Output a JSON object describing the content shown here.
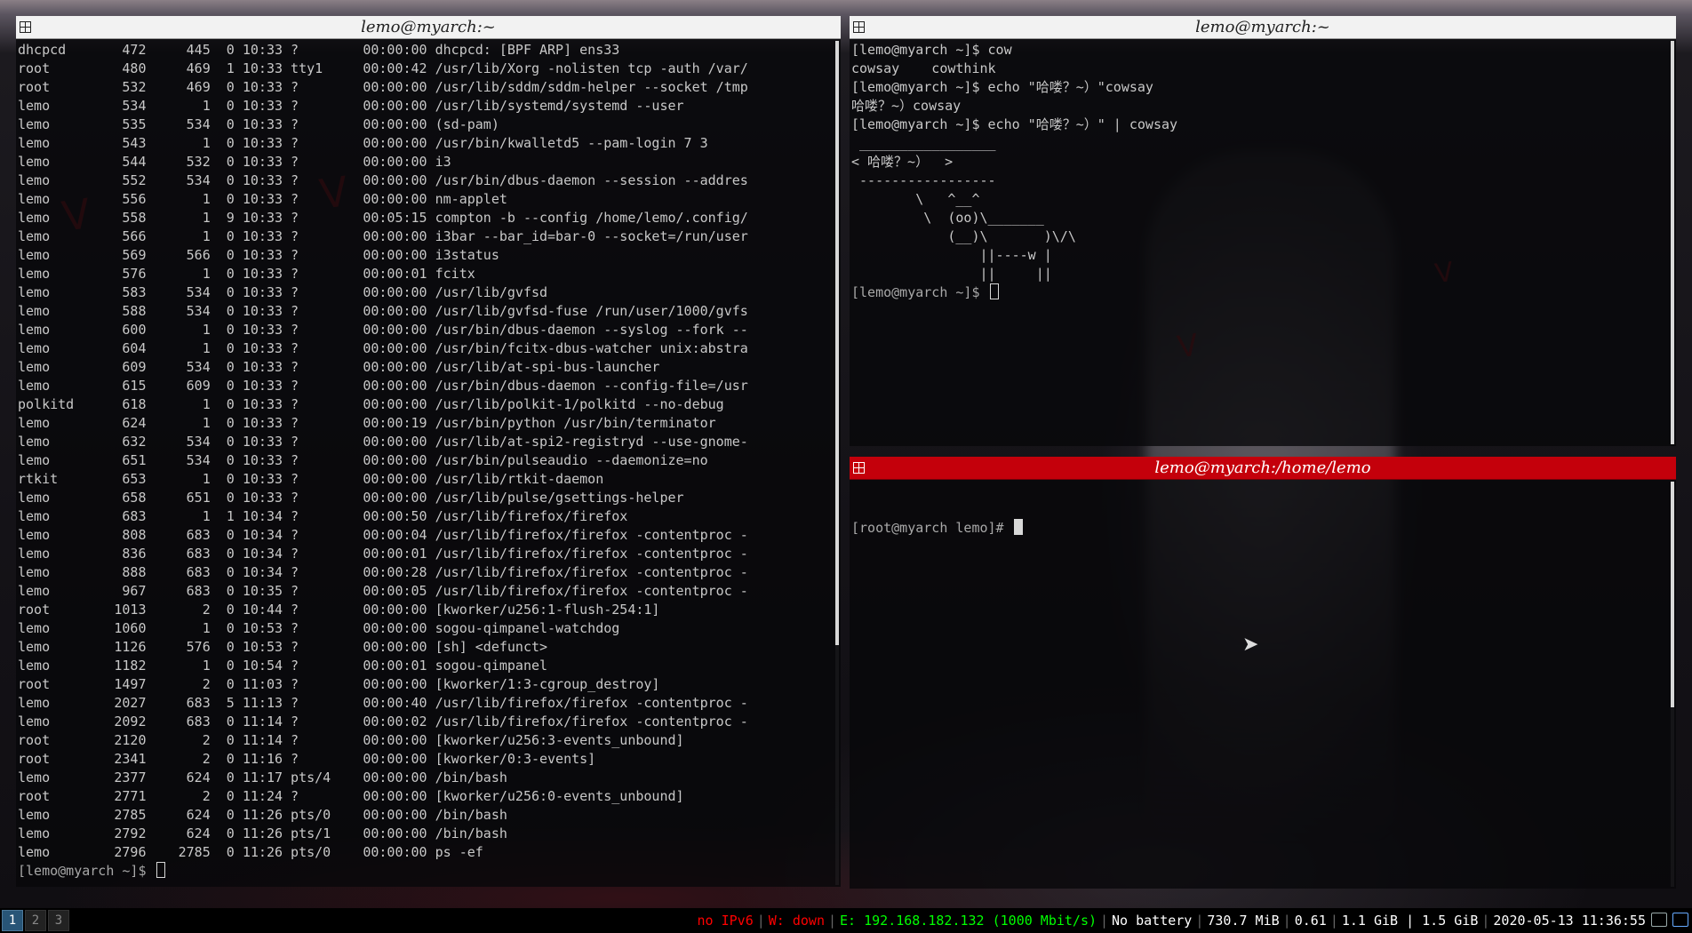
{
  "left_window": {
    "title": "lemo@myarch:~",
    "process_rows": [
      [
        "dhcpcd",
        "472",
        "445",
        "0",
        "10:33",
        "?",
        "00:00:00",
        "dhcpcd: [BPF ARP] ens33"
      ],
      [
        "root",
        "480",
        "469",
        "1",
        "10:33",
        "tty1",
        "00:00:42",
        "/usr/lib/Xorg -nolisten tcp -auth /var/"
      ],
      [
        "root",
        "532",
        "469",
        "0",
        "10:33",
        "?",
        "00:00:00",
        "/usr/lib/sddm/sddm-helper --socket /tmp"
      ],
      [
        "lemo",
        "534",
        "1",
        "0",
        "10:33",
        "?",
        "00:00:00",
        "/usr/lib/systemd/systemd --user"
      ],
      [
        "lemo",
        "535",
        "534",
        "0",
        "10:33",
        "?",
        "00:00:00",
        "(sd-pam)"
      ],
      [
        "lemo",
        "543",
        "1",
        "0",
        "10:33",
        "?",
        "00:00:00",
        "/usr/bin/kwalletd5 --pam-login 7 3"
      ],
      [
        "lemo",
        "544",
        "532",
        "0",
        "10:33",
        "?",
        "00:00:00",
        "i3"
      ],
      [
        "lemo",
        "552",
        "534",
        "0",
        "10:33",
        "?",
        "00:00:00",
        "/usr/bin/dbus-daemon --session --addres"
      ],
      [
        "lemo",
        "556",
        "1",
        "0",
        "10:33",
        "?",
        "00:00:00",
        "nm-applet"
      ],
      [
        "lemo",
        "558",
        "1",
        "9",
        "10:33",
        "?",
        "00:05:15",
        "compton -b --config /home/lemo/.config/"
      ],
      [
        "lemo",
        "566",
        "1",
        "0",
        "10:33",
        "?",
        "00:00:00",
        "i3bar --bar_id=bar-0 --socket=/run/user"
      ],
      [
        "lemo",
        "569",
        "566",
        "0",
        "10:33",
        "?",
        "00:00:00",
        "i3status"
      ],
      [
        "lemo",
        "576",
        "1",
        "0",
        "10:33",
        "?",
        "00:00:01",
        "fcitx"
      ],
      [
        "lemo",
        "583",
        "534",
        "0",
        "10:33",
        "?",
        "00:00:00",
        "/usr/lib/gvfsd"
      ],
      [
        "lemo",
        "588",
        "534",
        "0",
        "10:33",
        "?",
        "00:00:00",
        "/usr/lib/gvfsd-fuse /run/user/1000/gvfs"
      ],
      [
        "lemo",
        "600",
        "1",
        "0",
        "10:33",
        "?",
        "00:00:00",
        "/usr/bin/dbus-daemon --syslog --fork --"
      ],
      [
        "lemo",
        "604",
        "1",
        "0",
        "10:33",
        "?",
        "00:00:00",
        "/usr/bin/fcitx-dbus-watcher unix:abstra"
      ],
      [
        "lemo",
        "609",
        "534",
        "0",
        "10:33",
        "?",
        "00:00:00",
        "/usr/lib/at-spi-bus-launcher"
      ],
      [
        "lemo",
        "615",
        "609",
        "0",
        "10:33",
        "?",
        "00:00:00",
        "/usr/bin/dbus-daemon --config-file=/usr"
      ],
      [
        "polkitd",
        "618",
        "1",
        "0",
        "10:33",
        "?",
        "00:00:00",
        "/usr/lib/polkit-1/polkitd --no-debug"
      ],
      [
        "lemo",
        "624",
        "1",
        "0",
        "10:33",
        "?",
        "00:00:19",
        "/usr/bin/python /usr/bin/terminator"
      ],
      [
        "lemo",
        "632",
        "534",
        "0",
        "10:33",
        "?",
        "00:00:00",
        "/usr/lib/at-spi2-registryd --use-gnome-"
      ],
      [
        "lemo",
        "651",
        "534",
        "0",
        "10:33",
        "?",
        "00:00:00",
        "/usr/bin/pulseaudio --daemonize=no"
      ],
      [
        "rtkit",
        "653",
        "1",
        "0",
        "10:33",
        "?",
        "00:00:00",
        "/usr/lib/rtkit-daemon"
      ],
      [
        "lemo",
        "658",
        "651",
        "0",
        "10:33",
        "?",
        "00:00:00",
        "/usr/lib/pulse/gsettings-helper"
      ],
      [
        "lemo",
        "683",
        "1",
        "1",
        "10:34",
        "?",
        "00:00:50",
        "/usr/lib/firefox/firefox"
      ],
      [
        "lemo",
        "808",
        "683",
        "0",
        "10:34",
        "?",
        "00:00:04",
        "/usr/lib/firefox/firefox -contentproc -"
      ],
      [
        "lemo",
        "836",
        "683",
        "0",
        "10:34",
        "?",
        "00:00:01",
        "/usr/lib/firefox/firefox -contentproc -"
      ],
      [
        "lemo",
        "888",
        "683",
        "0",
        "10:34",
        "?",
        "00:00:28",
        "/usr/lib/firefox/firefox -contentproc -"
      ],
      [
        "lemo",
        "967",
        "683",
        "0",
        "10:35",
        "?",
        "00:00:05",
        "/usr/lib/firefox/firefox -contentproc -"
      ],
      [
        "root",
        "1013",
        "2",
        "0",
        "10:44",
        "?",
        "00:00:00",
        "[kworker/u256:1-flush-254:1]"
      ],
      [
        "lemo",
        "1060",
        "1",
        "0",
        "10:53",
        "?",
        "00:00:00",
        "sogou-qimpanel-watchdog"
      ],
      [
        "lemo",
        "1126",
        "576",
        "0",
        "10:53",
        "?",
        "00:00:00",
        "[sh] <defunct>"
      ],
      [
        "lemo",
        "1182",
        "1",
        "0",
        "10:54",
        "?",
        "00:00:01",
        "sogou-qimpanel"
      ],
      [
        "root",
        "1497",
        "2",
        "0",
        "11:03",
        "?",
        "00:00:00",
        "[kworker/1:3-cgroup_destroy]"
      ],
      [
        "lemo",
        "2027",
        "683",
        "5",
        "11:13",
        "?",
        "00:00:40",
        "/usr/lib/firefox/firefox -contentproc -"
      ],
      [
        "lemo",
        "2092",
        "683",
        "0",
        "11:14",
        "?",
        "00:00:02",
        "/usr/lib/firefox/firefox -contentproc -"
      ],
      [
        "root",
        "2120",
        "2",
        "0",
        "11:14",
        "?",
        "00:00:00",
        "[kworker/u256:3-events_unbound]"
      ],
      [
        "root",
        "2341",
        "2",
        "0",
        "11:16",
        "?",
        "00:00:00",
        "[kworker/0:3-events]"
      ],
      [
        "lemo",
        "2377",
        "624",
        "0",
        "11:17",
        "pts/4",
        "00:00:00",
        "/bin/bash"
      ],
      [
        "root",
        "2771",
        "2",
        "0",
        "11:24",
        "?",
        "00:00:00",
        "[kworker/u256:0-events_unbound]"
      ],
      [
        "lemo",
        "2785",
        "624",
        "0",
        "11:26",
        "pts/0",
        "00:00:00",
        "/bin/bash"
      ],
      [
        "lemo",
        "2792",
        "624",
        "0",
        "11:26",
        "pts/1",
        "00:00:00",
        "/bin/bash"
      ],
      [
        "lemo",
        "2796",
        "2785",
        "0",
        "11:26",
        "pts/0",
        "00:00:00",
        "ps -ef"
      ]
    ],
    "prompt": "[lemo@myarch ~]$ "
  },
  "top_right_window": {
    "title": "lemo@myarch:~",
    "lines": [
      "[lemo@myarch ~]$ cow",
      "cowsay    cowthink",
      "[lemo@myarch ~]$ echo \"哈喽？~）\"cowsay",
      "哈喽？~）cowsay",
      "[lemo@myarch ~]$ echo \"哈喽？~）\" | cowsay",
      " _________________",
      "< 哈喽？~）  >",
      " -----------------",
      "        \\   ^__^",
      "         \\  (oo)\\_______",
      "            (__)\\       )\\/\\",
      "                ||----w |",
      "                ||     ||"
    ],
    "prompt": "[lemo@myarch ~]$ "
  },
  "bottom_right_window": {
    "title": "lemo@myarch:/home/lemo",
    "prompt": "[root@myarch lemo]# "
  },
  "taskbar": {
    "workspaces": [
      "1",
      "2",
      "3"
    ],
    "focused_workspace": "1",
    "status": {
      "ipv6": "no IPv6",
      "wireless": "W: down",
      "ethernet": "E: 192.168.182.132 (1000 Mbit/s)",
      "battery": "No battery",
      "disk": "730.7 MiB",
      "load": "0.61",
      "memory": "1.1 GiB | 1.5 GiB",
      "datetime": "2020-05-13 11:36:55"
    },
    "colors": {
      "ipv6": "#ff0000",
      "wireless": "#ff0000",
      "ethernet": "#00ff00",
      "default": "#ffffff"
    },
    "tray_icons": [
      "keyboard-icon",
      "network-icon"
    ]
  },
  "colors": {
    "active_titlebar": "#c4000b",
    "inactive_titlebar": "#f2f2f2",
    "terminal_text": "#c8c8c8"
  }
}
